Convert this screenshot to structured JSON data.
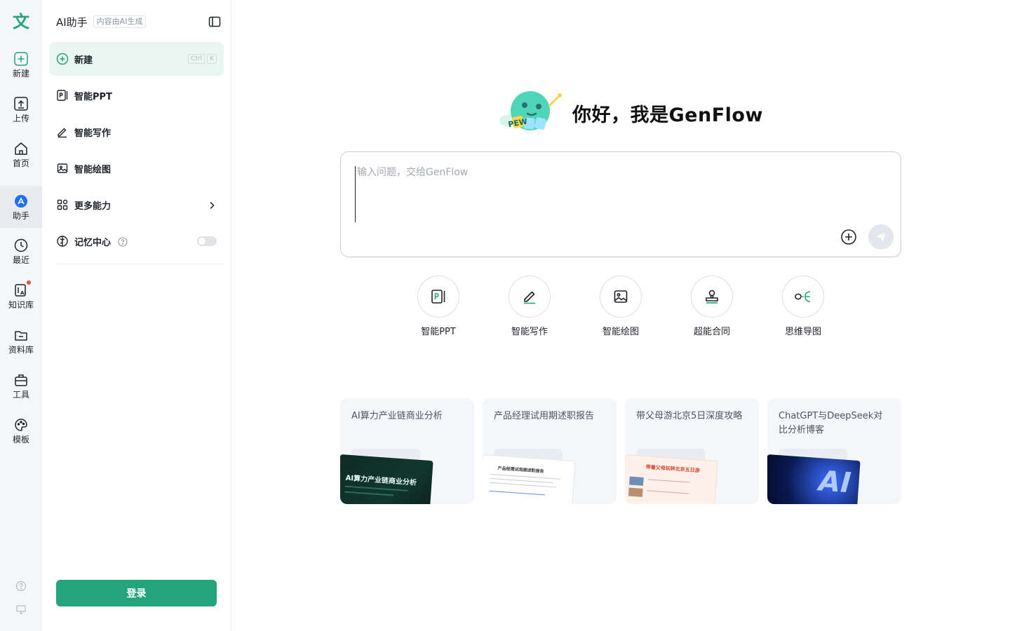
{
  "rail": {
    "logo_glyph": "文",
    "items": [
      {
        "label": "新建",
        "icon": "plus-square-icon"
      },
      {
        "label": "上传",
        "icon": "upload-icon"
      },
      {
        "label": "首页",
        "icon": "home-icon"
      },
      {
        "label": "助手",
        "icon": "assistant-icon"
      },
      {
        "label": "最近",
        "icon": "clock-icon"
      },
      {
        "label": "知识库",
        "icon": "knowledge-icon"
      },
      {
        "label": "资料库",
        "icon": "folder-icon"
      },
      {
        "label": "工具",
        "icon": "toolbox-icon"
      },
      {
        "label": "模板",
        "icon": "palette-icon"
      }
    ]
  },
  "sidebar": {
    "title": "AI助手",
    "tag": "内容由AI生成",
    "items": [
      {
        "label": "新建",
        "kbd": [
          "Ctrl",
          "K"
        ]
      },
      {
        "label": "智能PPT"
      },
      {
        "label": "智能写作"
      },
      {
        "label": "智能绘图"
      },
      {
        "label": "更多能力"
      },
      {
        "label": "记忆中心"
      }
    ],
    "login_label": "登录"
  },
  "main": {
    "greeting": "你好，我是GenFlow",
    "mascot_text": "PEW",
    "input_placeholder": "输入问题，交给GenFlow",
    "quick_actions": [
      {
        "label": "智能PPT"
      },
      {
        "label": "智能写作"
      },
      {
        "label": "智能绘图"
      },
      {
        "label": "超能合同"
      },
      {
        "label": "思维导图"
      }
    ],
    "cards": [
      {
        "title": "AI算力产业链商业分析",
        "thumb_text": "AI算力产业链商业分析"
      },
      {
        "title": "产品经理试用期述职报告",
        "thumb_text": "产品经理试用期述职报告"
      },
      {
        "title": "带父母游北京5日深度攻略",
        "thumb_text": "带着父母玩转北京五日游"
      },
      {
        "title": "ChatGPT与DeepSeek对比分析博客",
        "thumb_text": "AI"
      }
    ]
  },
  "colors": {
    "accent": "#23a47a",
    "active_bg": "#eaf6f1",
    "rail_bg": "#f5f6f8"
  }
}
